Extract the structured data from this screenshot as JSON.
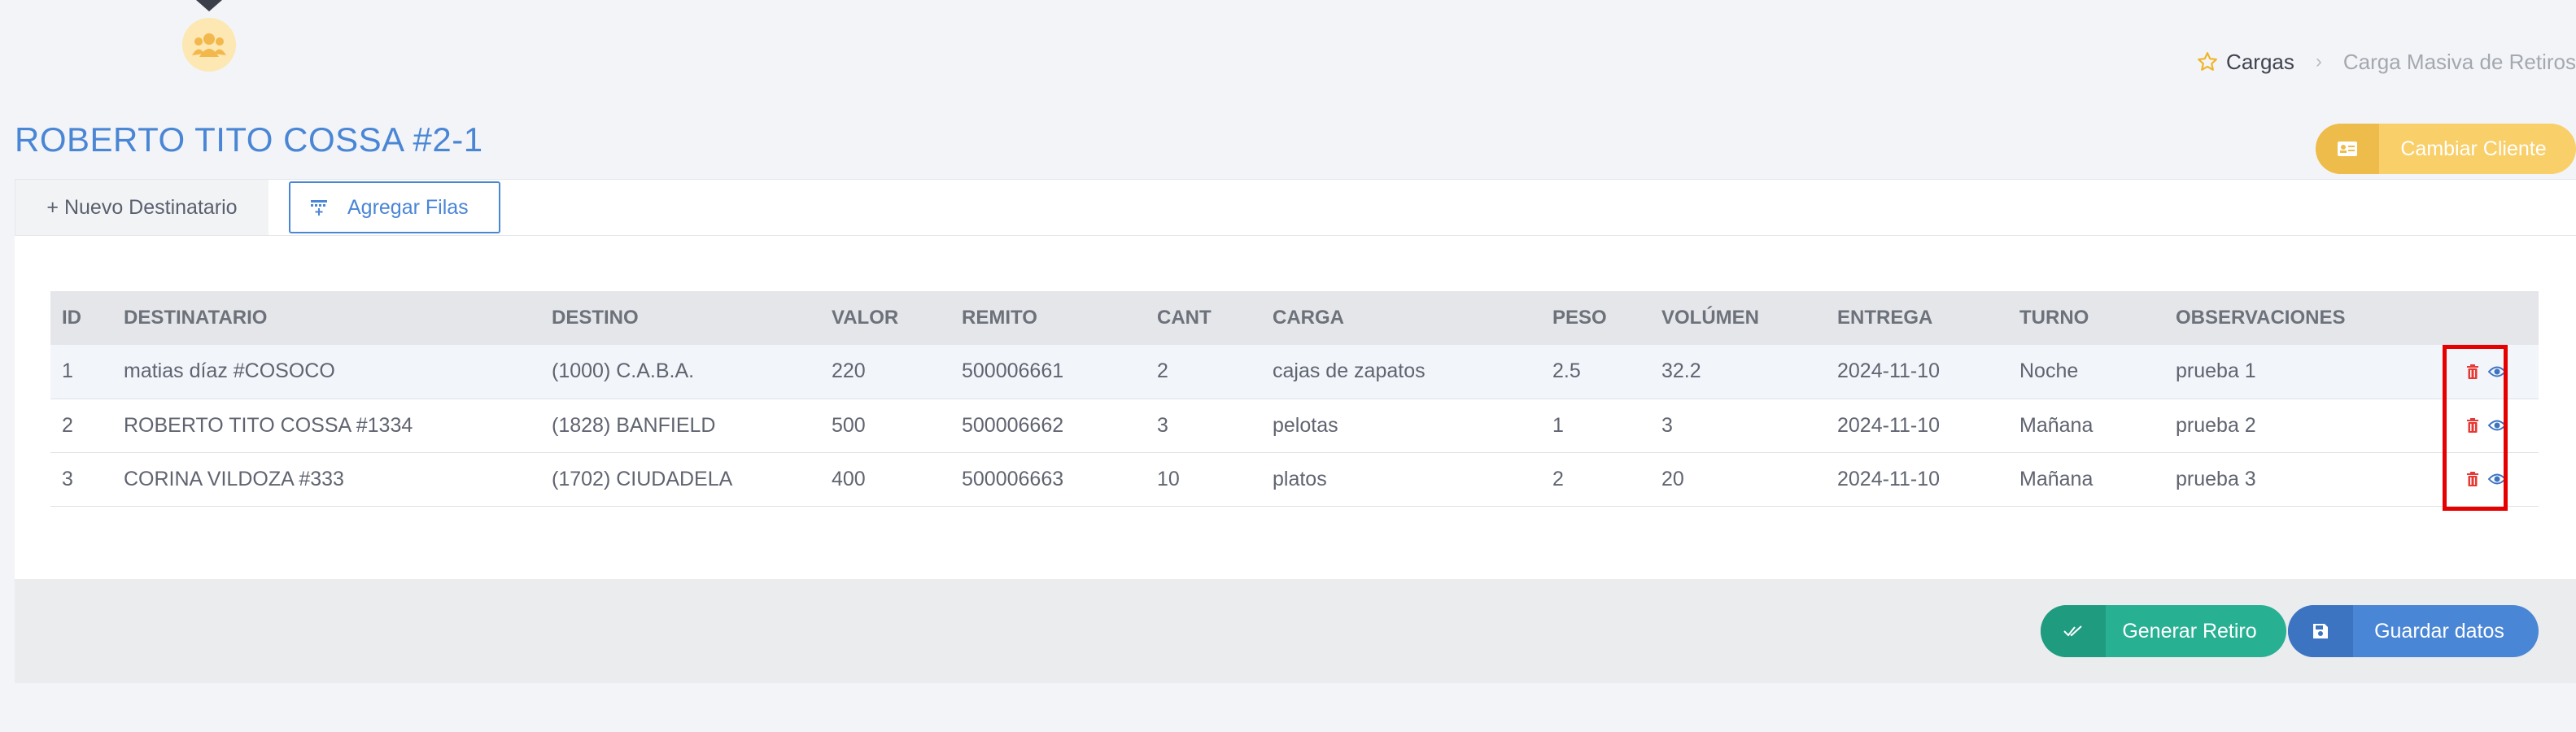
{
  "breadcrumb": {
    "items": [
      "Cargas",
      "Carga Masiva de Retiros"
    ],
    "separator": "›"
  },
  "page": {
    "title": "ROBERTO TITO COSSA #2-1"
  },
  "header_actions": {
    "cambiar_cliente": "Cambiar Cliente"
  },
  "tabs": {
    "nuevo_destinatario": "+ Nuevo Destinatario",
    "agregar_filas": "Agregar Filas"
  },
  "table": {
    "headers": [
      "ID",
      "DESTINATARIO",
      "DESTINO",
      "VALOR",
      "REMITO",
      "CANT",
      "CARGA",
      "PESO",
      "VOLÚMEN",
      "ENTREGA",
      "TURNO",
      "OBSERVACIONES",
      ""
    ],
    "rows": [
      [
        "1",
        "matias díaz #COSOCO",
        "(1000) C.A.B.A.",
        "220",
        "500006661",
        "2",
        "cajas de zapatos",
        "2.5",
        "32.2",
        "2024-11-10",
        "Noche",
        "prueba 1"
      ],
      [
        "2",
        "ROBERTO TITO COSSA #1334",
        "(1828) BANFIELD",
        "500",
        "500006662",
        "3",
        "pelotas",
        "1",
        "3",
        "2024-11-10",
        "Mañana",
        "prueba 2"
      ],
      [
        "3",
        "CORINA VILDOZA #333",
        "(1702) CIUDADELA",
        "400",
        "500006663",
        "10",
        "platos",
        "2",
        "20",
        "2024-11-10",
        "Mañana",
        "prueba 3"
      ]
    ]
  },
  "footer": {
    "generar_retiro": "Generar Retiro",
    "guardar_datos": "Guardar datos"
  },
  "icons": {
    "star": "star-icon",
    "users": "users-icon",
    "card": "id-card-icon",
    "delete": "trash-icon",
    "view": "eye-icon"
  },
  "colors": {
    "primary": "#4a86d6",
    "warning": "#f8cf69",
    "success": "#27b092",
    "danger": "#e53935",
    "highlight": "#e60000"
  }
}
